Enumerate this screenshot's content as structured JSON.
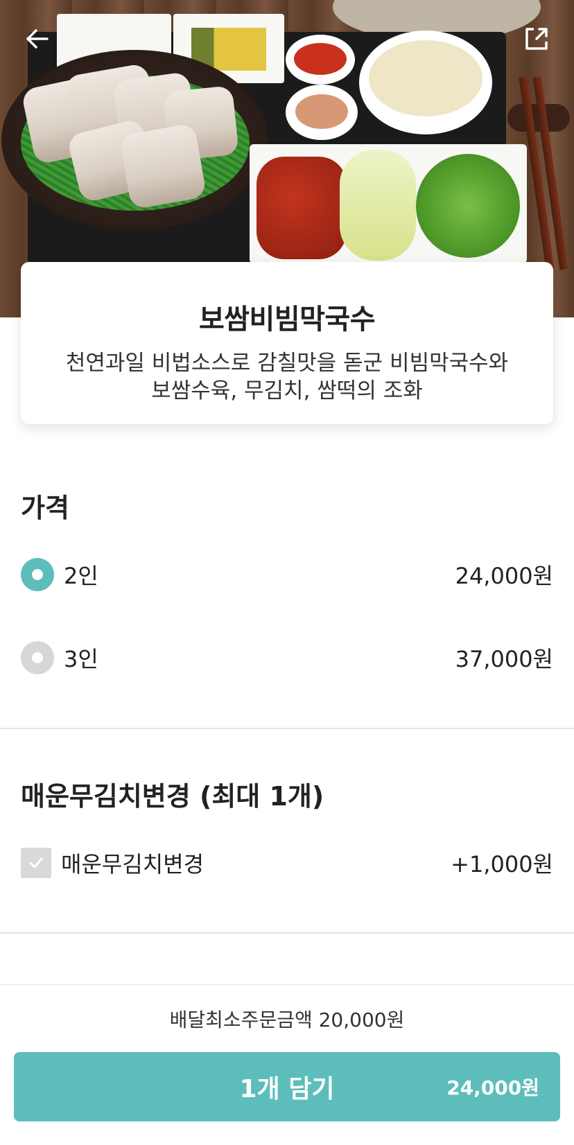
{
  "header": {
    "back_icon": "arrow-left-icon",
    "share_icon": "share-external-icon"
  },
  "menu": {
    "name": "보쌈비빔막국수",
    "desc_line1": "천연과일 비법소스로 감칠맛을 돋군 비빔막국수와",
    "desc_line2": "보쌈수육, 무김치, 쌈떡의 조화"
  },
  "price_section": {
    "title": "가격",
    "options": [
      {
        "label": "2인",
        "price": "24,000원",
        "selected": true
      },
      {
        "label": "3인",
        "price": "37,000원",
        "selected": false
      }
    ]
  },
  "addon_section": {
    "title": "매운무김치변경 (최대 1개)",
    "options": [
      {
        "label": "매운무김치변경",
        "price": "+1,000원",
        "checked": false
      }
    ]
  },
  "footer": {
    "min_order": "배달최소주문금액 20,000원",
    "cart_label": "1개 담기",
    "cart_total": "24,000원"
  },
  "colors": {
    "accent": "#5dbdbb",
    "radio_off": "#d7d7d7",
    "checkbox": "#d9d9d9"
  }
}
